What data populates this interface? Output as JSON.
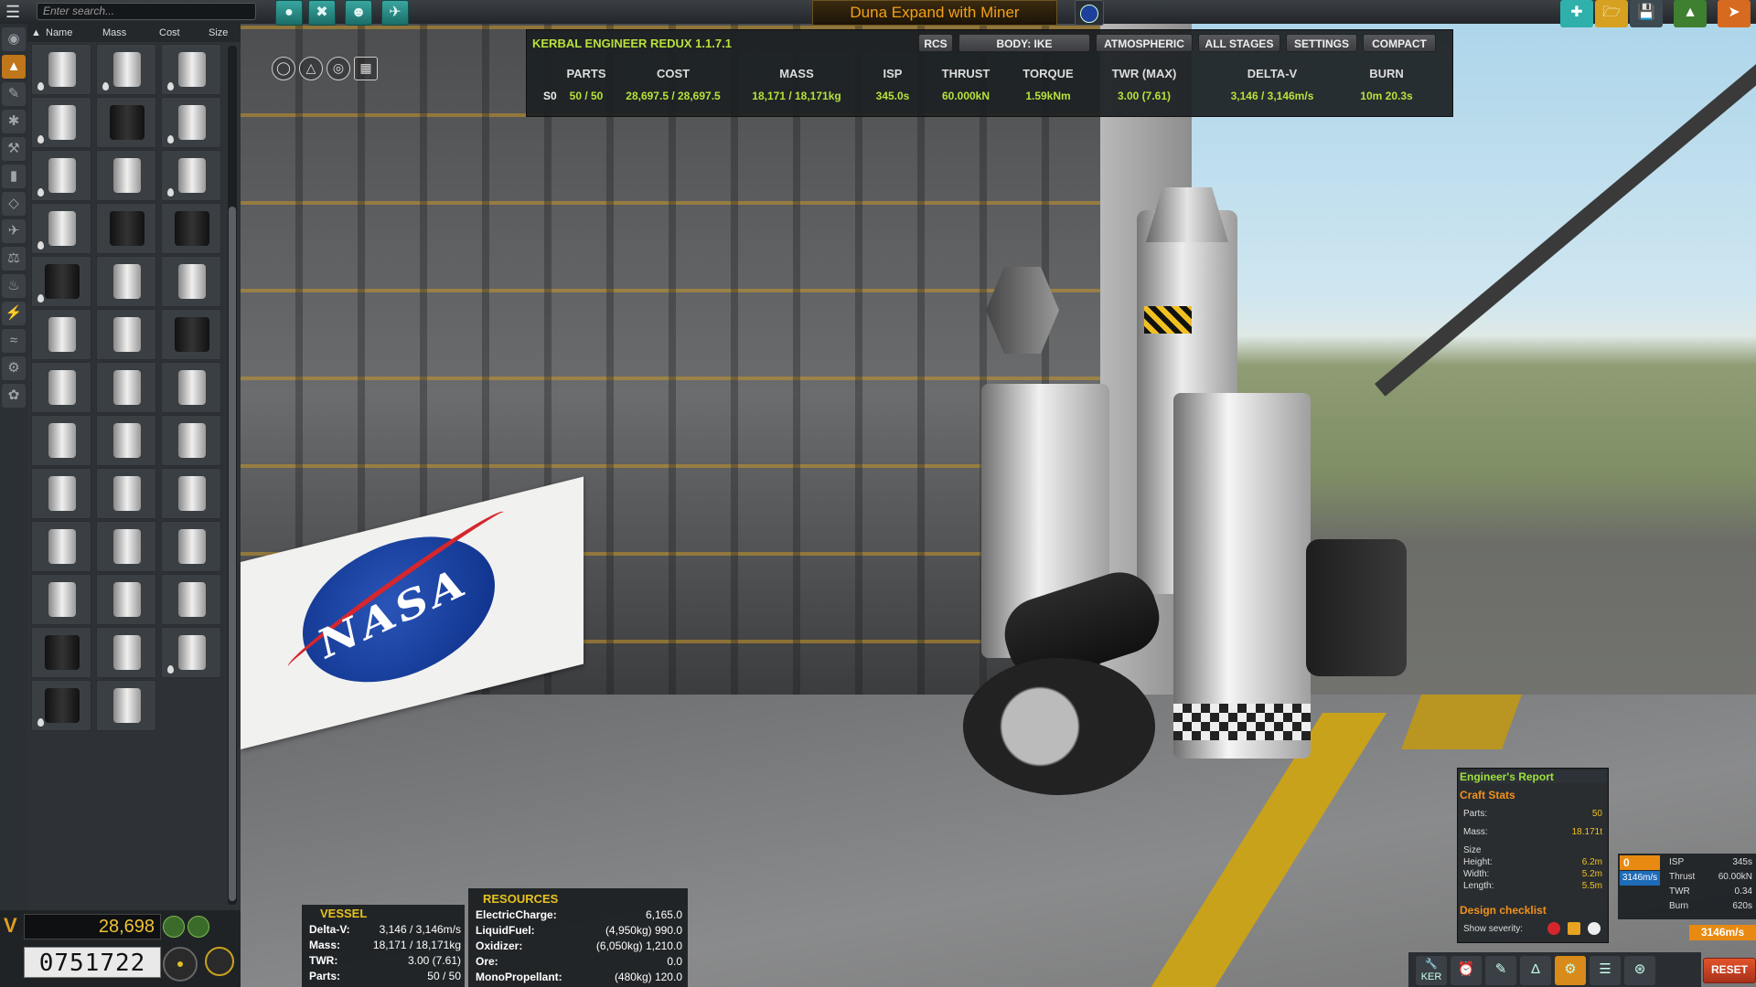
{
  "topbar": {
    "search_placeholder": "Enter search...",
    "craft_name": "Duna Expand with Miner",
    "left_tools": [
      "hamburger-menu-icon",
      "kerbal-icon",
      "wrench-crossed-icon",
      "astronaut-icon",
      "plane-icon"
    ],
    "right_tools": [
      "new-craft-icon",
      "load-craft-icon",
      "save-craft-icon",
      "launch-icon",
      "exit-icon"
    ]
  },
  "part_list": {
    "sort": {
      "name": "Name",
      "mass": "Mass",
      "cost": "Cost",
      "size": "Size"
    },
    "categories": [
      "pods-icon",
      "fuel-icon",
      "engine-icon",
      "control-icon",
      "structural-icon",
      "aero-icon",
      "utility-icon",
      "science-icon",
      "electrical-icon",
      "thermal-icon",
      "communication-icon",
      "ground-icon",
      "coupling-icon",
      "payload-icon",
      "robotics-icon",
      "cargo-icon"
    ]
  },
  "funds": {
    "currency_symbol": "V",
    "value": "28,698",
    "reputation": "0751722"
  },
  "ker": {
    "title": "KERBAL ENGINEER REDUX 1.1.7.1",
    "buttons": {
      "rcs": "RCS",
      "body": "BODY: IKE",
      "atmospheric": "ATMOSPHERIC",
      "all_stages": "ALL STAGES",
      "settings": "SETTINGS",
      "compact": "COMPACT"
    },
    "headers": {
      "parts": "PARTS",
      "cost": "COST",
      "mass": "MASS",
      "isp": "ISP",
      "thrust": "THRUST",
      "torque": "TORQUE",
      "twr": "TWR (MAX)",
      "deltav": "DELTA-V",
      "burn": "BURN"
    },
    "stage": {
      "label": "S0",
      "parts": "50 / 50",
      "cost": "28,697.5 / 28,697.5",
      "mass": "18,171 / 18,171kg",
      "isp": "345.0s",
      "thrust": "60.000kN",
      "torque": "1.59kNm",
      "twr": "3.00 (7.61)",
      "deltav": "3,146 / 3,146m/s",
      "burn": "10m 20.3s"
    }
  },
  "vessel": {
    "title": "VESSEL",
    "rows": [
      {
        "k": "Delta-V:",
        "v": "3,146 / 3,146m/s"
      },
      {
        "k": "Mass:",
        "v": "18,171 / 18,171kg"
      },
      {
        "k": "TWR:",
        "v": "3.00 (7.61)"
      },
      {
        "k": "Parts:",
        "v": "50 / 50"
      }
    ]
  },
  "resources": {
    "title": "RESOURCES",
    "rows": [
      {
        "k": "ElectricCharge:",
        "v": "6,165.0"
      },
      {
        "k": "LiquidFuel:",
        "v": "(4,950kg) 990.0"
      },
      {
        "k": "Oxidizer:",
        "v": "(6,050kg) 1,210.0"
      },
      {
        "k": "Ore:",
        "v": "0.0"
      },
      {
        "k": "MonoPropellant:",
        "v": "(480kg) 120.0"
      }
    ]
  },
  "engineers_report": {
    "title": "Engineer's Report",
    "craft_stats": "Craft Stats",
    "parts_label": "Parts:",
    "parts_value": "50",
    "mass_label": "Mass:",
    "mass_value": "18.171t",
    "size_label": "Size",
    "height_label": "Height:",
    "height_value": "6.2m",
    "width_label": "Width:",
    "width_value": "5.2m",
    "length_label": "Length:",
    "length_value": "5.5m",
    "design_checklist": "Design checklist",
    "show_severity": "Show severity:"
  },
  "dv_mini": {
    "stage_num": "0",
    "dv": "3146m/s",
    "isp_label": "ISP",
    "isp": "345s",
    "thrust_label": "Thrust",
    "thrust": "60.00kN",
    "twr_label": "TWR",
    "twr": "0.34",
    "burn_label": "Burn",
    "burn": "620s",
    "total": "3146m/s"
  },
  "app_bar": {
    "ker_label": "KER",
    "reset": "RESET",
    "apps": [
      "ker-icon",
      "alarm-clock-icon",
      "kerbal-alarm-icon",
      "delta-v-icon",
      "engineers-report-icon",
      "checklist-icon",
      "commnet-icon"
    ]
  },
  "scene": {
    "banner_text": "NASA"
  },
  "colors": {
    "ker_green": "#b8e23a",
    "accent_orange": "#f3a018",
    "teal_button": "#2a8f89"
  }
}
